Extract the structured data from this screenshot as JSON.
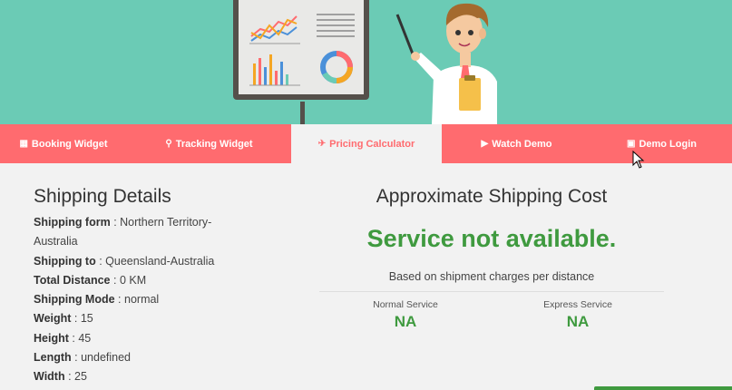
{
  "tabs": [
    {
      "label": "Booking Widget",
      "icon": "calculator-icon",
      "glyph": "▦"
    },
    {
      "label": "Tracking Widget",
      "icon": "search-icon",
      "glyph": "⚲"
    },
    {
      "label": "Pricing Calculator",
      "icon": "plane-icon",
      "glyph": "✈"
    },
    {
      "label": "Watch Demo",
      "icon": "youtube-play-icon",
      "glyph": "▶"
    },
    {
      "label": "Demo Login",
      "icon": "login-image-icon",
      "glyph": "▣"
    }
  ],
  "active_tab": "Pricing Calculator",
  "shipping_details": {
    "title": "Shipping Details",
    "from_label": "Shipping form",
    "from_value": "Northern Territory-Australia",
    "to_label": "Shipping to",
    "to_value": "Queensland-Australia",
    "distance_label": "Total Distance",
    "distance_value": "0 KM",
    "mode_label": "Shipping Mode",
    "mode_value": "normal",
    "weight_label": "Weight",
    "weight_value": "15",
    "height_label": "Height",
    "height_value": "45",
    "length_label": "Length",
    "length_value": "undefined",
    "width_label": "Width",
    "width_value": "25"
  },
  "cost": {
    "title": "Approximate Shipping Cost",
    "status": "Service not available.",
    "subtitle": "Based on shipment charges per distance",
    "normal_label": "Normal Service",
    "normal_value": "NA",
    "express_label": "Express Service",
    "express_value": "NA"
  },
  "colors": {
    "hero": "#6bcbb5",
    "tab_bar": "#ff6b6f",
    "success": "#3f9a3f"
  }
}
